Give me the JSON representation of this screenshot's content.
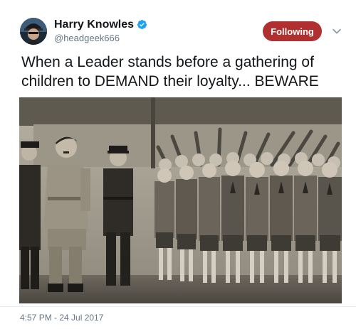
{
  "tweet": {
    "author": {
      "display_name": "Harry Knowles",
      "handle": "@headgeek666",
      "verified": true,
      "avatar_icon": "profile-avatar"
    },
    "follow_button_label": "Following",
    "follow_button_color": "#b0302f",
    "menu_icon": "chevron-down-icon",
    "text": "When a Leader stands before a gathering of children to DEMAND their loyalty... BEWARE",
    "timestamp": "4:57 PM - 24 Jul 2017",
    "media": {
      "type": "photo"
    }
  }
}
